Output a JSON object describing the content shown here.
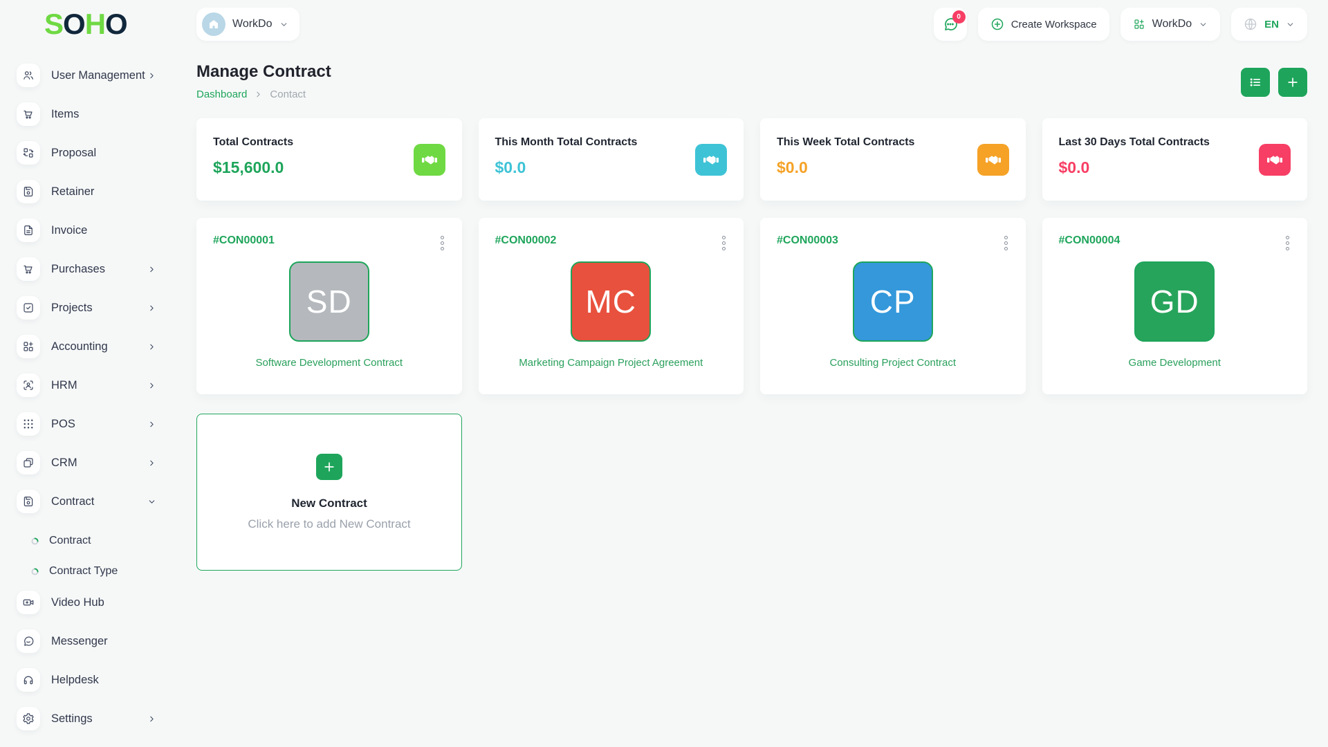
{
  "brand": {
    "letters": [
      {
        "ch": "S",
        "color": "#6fd943"
      },
      {
        "ch": "O",
        "color": "#11273b"
      },
      {
        "ch": "H",
        "color": "#6fd943"
      },
      {
        "ch": "O",
        "color": "#11273b"
      }
    ]
  },
  "header": {
    "workspace_switcher": {
      "label": "WorkDo",
      "icon": "building-icon"
    },
    "chat": {
      "icon": "chat-bubble-dots-icon",
      "badge": "0"
    },
    "create_workspace_label": "Create Workspace",
    "app_dropdown_label": "WorkDo",
    "language": {
      "icon": "globe-icon",
      "code": "EN"
    }
  },
  "page": {
    "title": "Manage Contract",
    "breadcrumb": {
      "home": "Dashboard",
      "current": "Contact"
    }
  },
  "colors": {
    "primary_green": "#1ea55b",
    "lime_green": "#6fd943",
    "cyan": "#3ec3d6",
    "orange": "#f5a227",
    "pink": "#f73e64"
  },
  "stats": [
    {
      "label": "Total Contracts",
      "amount": "$15,600.0",
      "icon": "handshake-icon",
      "tile_color": "#6fd943",
      "amount_color": "#1ea55b"
    },
    {
      "label": "This Month Total Contracts",
      "amount": "$0.0",
      "icon": "handshake-icon",
      "tile_color": "#3ec3d6",
      "amount_color": "#3ec3d6"
    },
    {
      "label": "This Week Total Contracts",
      "amount": "$0.0",
      "icon": "handshake-icon",
      "tile_color": "#f5a227",
      "amount_color": "#f5a227"
    },
    {
      "label": "Last 30 Days Total Contracts",
      "amount": "$0.0",
      "icon": "handshake-icon",
      "tile_color": "#f73e64",
      "amount_color": "#f73e64"
    }
  ],
  "contracts": [
    {
      "id": "#CON00001",
      "initials": "SD",
      "avatar_color": "#b5b9bd",
      "name": "Software Development Contract"
    },
    {
      "id": "#CON00002",
      "initials": "MC",
      "avatar_color": "#e8513d",
      "name": "Marketing Campaign Project Agreement"
    },
    {
      "id": "#CON00003",
      "initials": "CP",
      "avatar_color": "#3498db",
      "name": "Consulting Project Contract"
    },
    {
      "id": "#CON00004",
      "initials": "GD",
      "avatar_color": "#27a45b",
      "name": "Game Development"
    }
  ],
  "new_contract": {
    "title": "New Contract",
    "subtitle": "Click here to add New Contract"
  },
  "sidebar": {
    "items": [
      {
        "label": "User Management",
        "icon": "users-icon",
        "chevron": "right"
      },
      {
        "label": "Items",
        "icon": "cart-icon",
        "chevron": "none"
      },
      {
        "label": "Proposal",
        "icon": "swap-boxes-icon",
        "chevron": "none"
      },
      {
        "label": "Retainer",
        "icon": "save-icon",
        "chevron": "none"
      },
      {
        "label": "Invoice",
        "icon": "invoice-icon",
        "chevron": "none"
      },
      {
        "label": "Purchases",
        "icon": "cart-icon",
        "chevron": "right"
      },
      {
        "label": "Projects",
        "icon": "check-square-icon",
        "chevron": "right"
      },
      {
        "label": "Accounting",
        "icon": "grid-plus-icon",
        "chevron": "right"
      },
      {
        "label": "HRM",
        "icon": "scan-user-icon",
        "chevron": "right"
      },
      {
        "label": "POS",
        "icon": "dots-grid-icon",
        "chevron": "right"
      },
      {
        "label": "CRM",
        "icon": "overlap-squares-icon",
        "chevron": "right"
      },
      {
        "label": "Contract",
        "icon": "save-icon",
        "chevron": "down",
        "expanded": true,
        "children": [
          {
            "label": "Contract"
          },
          {
            "label": "Contract Type"
          }
        ]
      },
      {
        "label": "Video Hub",
        "icon": "video-icon",
        "chevron": "none"
      },
      {
        "label": "Messenger",
        "icon": "chat-icon",
        "chevron": "none"
      },
      {
        "label": "Helpdesk",
        "icon": "headphones-icon",
        "chevron": "none"
      },
      {
        "label": "Settings",
        "icon": "gear-icon",
        "chevron": "right"
      }
    ]
  }
}
